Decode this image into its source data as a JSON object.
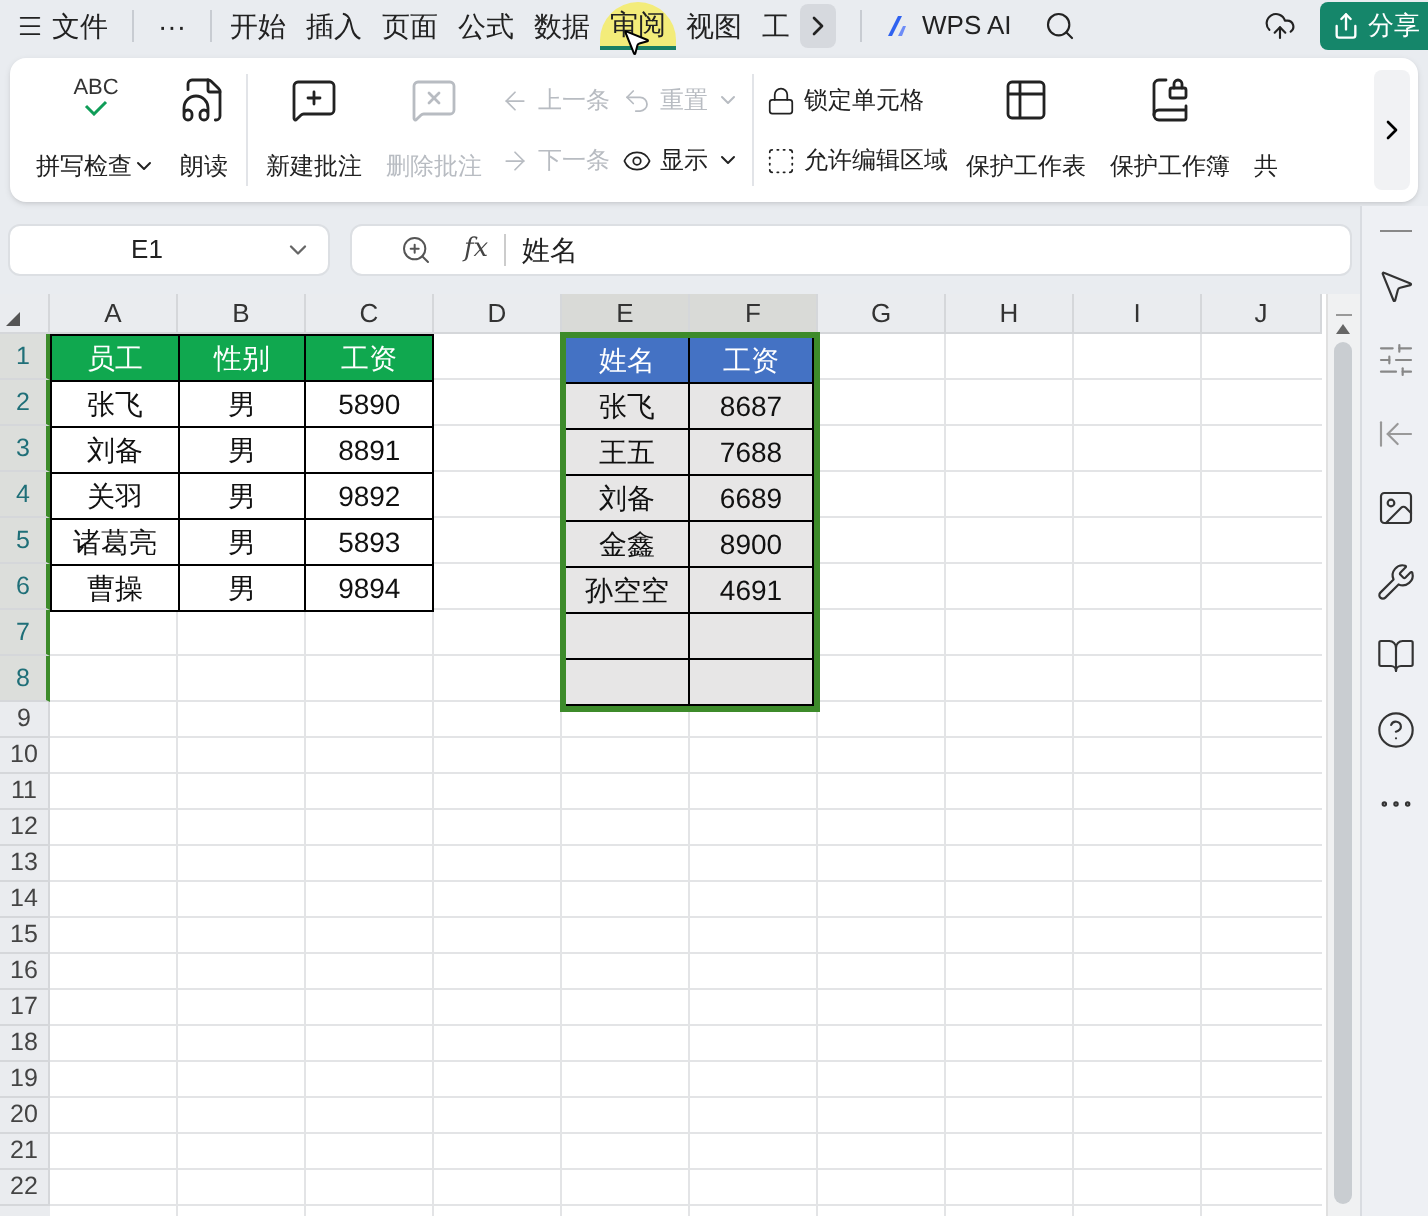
{
  "menu_bar": {
    "menu_label": "文件",
    "more": "···",
    "tabs": [
      {
        "label": "开始",
        "selected": false
      },
      {
        "label": "插入",
        "selected": false
      },
      {
        "label": "页面",
        "selected": false
      },
      {
        "label": "公式",
        "selected": false
      },
      {
        "label": "数据",
        "selected": false
      },
      {
        "label": "审阅",
        "selected": true
      },
      {
        "label": "视图",
        "selected": false
      },
      {
        "label": "工",
        "selected": false
      }
    ],
    "ai_label": "WPS AI",
    "share_label": "分享"
  },
  "ribbon": {
    "groups": [
      {
        "items": [
          {
            "kind": "large",
            "icon_text": "ABC",
            "label": "拼写检查",
            "dropdown": true,
            "disabled": false
          },
          {
            "kind": "large",
            "label": "朗读",
            "dropdown": false,
            "disabled": false
          }
        ]
      },
      {
        "items": [
          {
            "kind": "large",
            "label": "新建批注",
            "dropdown": false,
            "disabled": false
          },
          {
            "kind": "large",
            "label": "删除批注",
            "dropdown": false,
            "disabled": true
          },
          {
            "kind": "stack",
            "children": [
              {
                "label": "上一条",
                "dropdown": false,
                "disabled": true
              },
              {
                "label": "下一条",
                "dropdown": false,
                "disabled": true
              }
            ]
          },
          {
            "kind": "stack",
            "children": [
              {
                "label": "重置",
                "dropdown": true,
                "disabled": true
              },
              {
                "label": "显示",
                "dropdown": true,
                "disabled": false
              }
            ]
          }
        ]
      },
      {
        "items": [
          {
            "kind": "stack",
            "children": [
              {
                "label": "锁定单元格",
                "dropdown": false,
                "disabled": false
              },
              {
                "label": "允许编辑区域",
                "dropdown": false,
                "disabled": false
              }
            ]
          },
          {
            "kind": "large",
            "label": "保护工作表",
            "dropdown": false,
            "disabled": false
          },
          {
            "kind": "large",
            "label": "保护工作簿",
            "dropdown": false,
            "disabled": false
          },
          {
            "kind": "large",
            "label": "共",
            "dropdown": false,
            "disabled": false
          }
        ]
      }
    ]
  },
  "formula_bar": {
    "name_box": "E1",
    "function_label": "fx",
    "formula": "姓名"
  },
  "columns": [
    {
      "label": "A",
      "selected": false
    },
    {
      "label": "B",
      "selected": false
    },
    {
      "label": "C",
      "selected": false
    },
    {
      "label": "D",
      "selected": false
    },
    {
      "label": "E",
      "selected": true
    },
    {
      "label": "F",
      "selected": true
    },
    {
      "label": "G",
      "selected": false
    },
    {
      "label": "H",
      "selected": false
    },
    {
      "label": "I",
      "selected": false
    },
    {
      "label": "J",
      "selected": false
    }
  ],
  "rows": [
    {
      "label": "1",
      "selected": true
    },
    {
      "label": "2",
      "selected": true
    },
    {
      "label": "3",
      "selected": true
    },
    {
      "label": "4",
      "selected": true
    },
    {
      "label": "5",
      "selected": true
    },
    {
      "label": "6",
      "selected": true
    },
    {
      "label": "7",
      "selected": true
    },
    {
      "label": "8",
      "selected": true
    },
    {
      "label": "9",
      "selected": false
    },
    {
      "label": "10",
      "selected": false
    },
    {
      "label": "11",
      "selected": false
    },
    {
      "label": "12",
      "selected": false
    },
    {
      "label": "13",
      "selected": false
    },
    {
      "label": "14",
      "selected": false
    },
    {
      "label": "15",
      "selected": false
    },
    {
      "label": "16",
      "selected": false
    },
    {
      "label": "17",
      "selected": false
    },
    {
      "label": "18",
      "selected": false
    },
    {
      "label": "19",
      "selected": false
    },
    {
      "label": "20",
      "selected": false
    },
    {
      "label": "21",
      "selected": false
    },
    {
      "label": "22",
      "selected": false
    }
  ],
  "employee_table": {
    "header": [
      "员工",
      "性别",
      "工资"
    ],
    "rows": [
      [
        "张飞",
        "男",
        "5890"
      ],
      [
        "刘备",
        "男",
        "8891"
      ],
      [
        "关羽",
        "男",
        "9892"
      ],
      [
        "诸葛亮",
        "男",
        "5893"
      ],
      [
        "曹操",
        "男",
        "9894"
      ]
    ]
  },
  "salary_table": {
    "header": [
      "姓名",
      "工资"
    ],
    "rows": [
      [
        "张飞",
        "8687"
      ],
      [
        "王五",
        "7688"
      ],
      [
        "刘备",
        "6689"
      ],
      [
        "金鑫",
        "8900"
      ],
      [
        "孙空空",
        "4691"
      ]
    ]
  }
}
